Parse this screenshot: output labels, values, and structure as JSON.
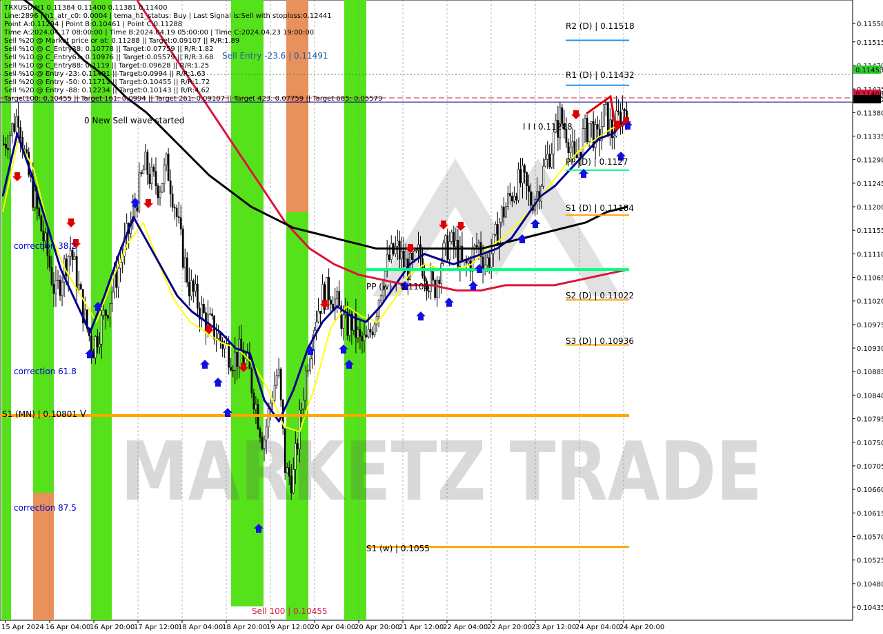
{
  "info_lines": [
    "TRXUSD,H1  0.11384 0.11400 0.11381 0.11400",
    "Line:2896  |  h1_atr_c0: 0.0004  |  tema_h1_status: Buy  |  Last Signal is:Sell with stoploss:0.12441",
    "Point A:0.11294  |  Point B:0.10461  |  Point C:0.11288",
    "Time A:2024.04.17 08:00:00  |  Time B:2024.04.19 05:00:00  |  Time C:2024.04.23 19:00:00",
    "Sell %20 @ Market price or at: 0.11288  ||  Target:0.09107  ||  R/R:1.89",
    "Sell %10 @ C_Entry38: 0.10778  ||  Target:0.07759  ||  R/R:1.82",
    "Sell %10 @ C_Entry61: 0.10976  ||  Target:0.05579  ||  R/R:3.68",
    "Sell %10 @ C_Entry88: 0.1119  ||  Target:0.09628  ||  R/R:1.25",
    "Sell %10 @ Entry -23: 0.11491  ||  Target:0.0994  ||  R/R:1.63",
    "Sell %20 @ Entry -50: 0.11711  ||  Target:0.10455  ||  R/R:1.72",
    "Sell %20 @ Entry -88: 0.12234  ||  Target:0.10143  ||  R/R:4.62",
    "Target100: 0.10455  ||  Target 161: 0.0994  ||  Target 261: 0.09107  ||  Target 423: 0.07759  ||  Target 685: 0.05579"
  ],
  "labels": {
    "sell_entry": "Sell Entry -23.6 | 0.11491",
    "new_wave": "0 New Sell wave started",
    "wave_marker": "I I I 0.11288",
    "sell100": "Sell 100 | 0.10455",
    "corr382": "correction 38.2",
    "corr618": "correction 61.8",
    "corr875": "correction 87.5",
    "s1_mn": "S1 (MN) | 0.10801",
    "pp_w": "PP (w) | 0.1108",
    "s1_w": "S1 (w) | 0.1055",
    "r2_d": "R2 (D) | 0.11518",
    "r1_d": "R1 (D) | 0.11432",
    "pp_d": "PP (D) | 0.1127",
    "s1_d": "S1 (D) | 0.11184",
    "s2_d": "S2 (D) | 0.11022",
    "s3_d": "S3 (D) | 0.10936"
  },
  "watermark": "MARKETZ TRADE",
  "price_tags": [
    "0.11453",
    "0.11408",
    "0.11400"
  ],
  "colors": {
    "green_zone": "#55e21b",
    "orange_zone": "#e8915a",
    "level_orange": "#ffa500",
    "level_blue": "#1e90ff",
    "level_green": "#00ff7f",
    "ma_black": "#000000",
    "ma_red": "#dc143c",
    "ma_navy": "#00008b",
    "ma_yellow": "#ffff00",
    "tag_green": "#32cd32",
    "tag_red": "#dc143c",
    "tag_black": "#000000"
  },
  "chart_data": {
    "type": "candlestick",
    "symbol": "TRXUSD",
    "timeframe": "H1",
    "ylim": [
      0.1041,
      0.11595
    ],
    "y_ticks": [
      "0.11550",
      "0.11515",
      "0.11470",
      "0.11425",
      "0.11380",
      "0.11335",
      "0.11290",
      "0.11245",
      "0.11200",
      "0.11155",
      "0.11110",
      "0.11065",
      "0.11020",
      "0.10975",
      "0.10930",
      "0.10885",
      "0.10840",
      "0.10795",
      "0.10750",
      "0.10705",
      "0.10660",
      "0.10615",
      "0.10570",
      "0.10525",
      "0.10480",
      "0.10435"
    ],
    "x_ticks": [
      "15 Apr 2024",
      "16 Apr 04:00",
      "16 Apr 20:00",
      "17 Apr 12:00",
      "18 Apr 04:00",
      "18 Apr 20:00",
      "19 Apr 12:00",
      "20 Apr 04:00",
      "20 Apr 20:00",
      "21 Apr 12:00",
      "22 Apr 04:00",
      "22 Apr 20:00",
      "23 Apr 12:00",
      "24 Apr 04:00",
      "24 Apr 20:00"
    ],
    "levels": [
      {
        "name": "S1 (MN)",
        "value": 0.10801,
        "color": "#ffa500"
      },
      {
        "name": "PP (w)",
        "value": 0.1108,
        "color": "#00ff7f"
      },
      {
        "name": "S1 (w)",
        "value": 0.1055,
        "color": "#ffa500"
      },
      {
        "name": "R2 (D)",
        "value": 0.11518,
        "color": "#1e90ff"
      },
      {
        "name": "R1 (D)",
        "value": 0.11432,
        "color": "#1e90ff"
      },
      {
        "name": "PP (D)",
        "value": 0.1127,
        "color": "#00ff7f"
      },
      {
        "name": "S1 (D)",
        "value": 0.11184,
        "color": "#ffa500"
      },
      {
        "name": "S2 (D)",
        "value": 0.11022,
        "color": "#ffa500"
      },
      {
        "name": "S3 (D)",
        "value": 0.10936,
        "color": "#ffa500"
      }
    ],
    "price_lines": [
      {
        "value": 0.11453,
        "style": "dotted",
        "color": "#228b22"
      },
      {
        "value": 0.11408,
        "style": "dashed",
        "color": "#dc143c"
      },
      {
        "value": 0.114,
        "style": "solid",
        "color": "#00008b"
      }
    ],
    "close_path": [
      0.1132,
      0.11345,
      0.1138,
      0.1128,
      0.1122,
      0.1116,
      0.111,
      0.1103,
      0.1108,
      0.1112,
      0.1105,
      0.1098,
      0.1093,
      0.1097,
      0.1101,
      0.1106,
      0.1111,
      0.1116,
      0.1122,
      0.1128,
      0.1125,
      0.1124,
      0.1128,
      0.1121,
      0.1112,
      0.1105,
      0.1102,
      0.1099,
      0.1097,
      0.1095,
      0.1093,
      0.1091,
      0.1092,
      0.1089,
      0.1082,
      0.1075,
      0.1083,
      0.1089,
      0.1069,
      0.1068,
      0.108,
      0.1091,
      0.1099,
      0.1103,
      0.1104,
      0.1101,
      0.1097,
      0.1098,
      0.1094,
      0.1094,
      0.1099,
      0.1106,
      0.111,
      0.1112,
      0.1109,
      0.1108,
      0.1111,
      0.1107,
      0.1104,
      0.111,
      0.1113,
      0.1112,
      0.1108,
      0.111,
      0.1113,
      0.1109,
      0.1112,
      0.1118,
      0.1121,
      0.1124,
      0.1125,
      0.1121,
      0.1123,
      0.1128,
      0.1132,
      0.1137,
      0.1134,
      0.1128,
      0.1133,
      0.1136,
      0.1132,
      0.1138,
      0.1134,
      0.1137,
      0.114
    ],
    "ma_black": [
      0.1163,
      0.116,
      0.1157,
      0.1152,
      0.1148,
      0.1145,
      0.1141,
      0.1138,
      0.1134,
      0.113,
      0.1126,
      0.1123,
      0.112,
      0.1118,
      0.1116,
      0.1115,
      0.1114,
      0.1113,
      0.1112,
      0.1112,
      0.1112,
      0.1112,
      0.1112,
      0.1112,
      0.1113,
      0.1114,
      0.1115,
      0.1116,
      0.1117,
      0.1119,
      0.112
    ],
    "ma_red": [
      0.1176,
      0.1168,
      0.1159,
      0.1152,
      0.1145,
      0.1138,
      0.1131,
      0.1124,
      0.1117,
      0.1112,
      0.1109,
      0.1107,
      0.1106,
      0.1105,
      0.1105,
      0.1104,
      0.1104,
      0.1105,
      0.1105,
      0.1105,
      0.1106,
      0.1107,
      0.1108
    ],
    "ma_navy": [
      0.1122,
      0.1134,
      0.1126,
      0.1117,
      0.1108,
      0.1102,
      0.1096,
      0.1103,
      0.1111,
      0.1118,
      0.1113,
      0.1108,
      0.1103,
      0.11,
      0.1098,
      0.1096,
      0.1093,
      0.1092,
      0.1083,
      0.1079,
      0.1085,
      0.1093,
      0.1098,
      0.1101,
      0.1099,
      0.1098,
      0.1101,
      0.1105,
      0.1109,
      0.1111,
      0.111,
      0.1109,
      0.111,
      0.1111,
      0.1112,
      0.1114,
      0.1118,
      0.1122,
      0.1124,
      0.1127,
      0.113,
      0.1133,
      0.1134,
      0.1137
    ],
    "ma_yellow": [
      0.1119,
      0.1133,
      0.1127,
      0.1115,
      0.1108,
      0.1103,
      0.1098,
      0.1106,
      0.1113,
      0.1117,
      0.1109,
      0.1102,
      0.1098,
      0.1096,
      0.1094,
      0.1093,
      0.109,
      0.1085,
      0.1078,
      0.1077,
      0.1086,
      0.1097,
      0.1101,
      0.1099,
      0.1098,
      0.1102,
      0.1107,
      0.1109,
      0.1108,
      0.1108,
      0.1109,
      0.1112,
      0.1114,
      0.1117,
      0.112,
      0.1124,
      0.1128,
      0.1131,
      0.1133,
      0.1135,
      0.1136
    ]
  }
}
